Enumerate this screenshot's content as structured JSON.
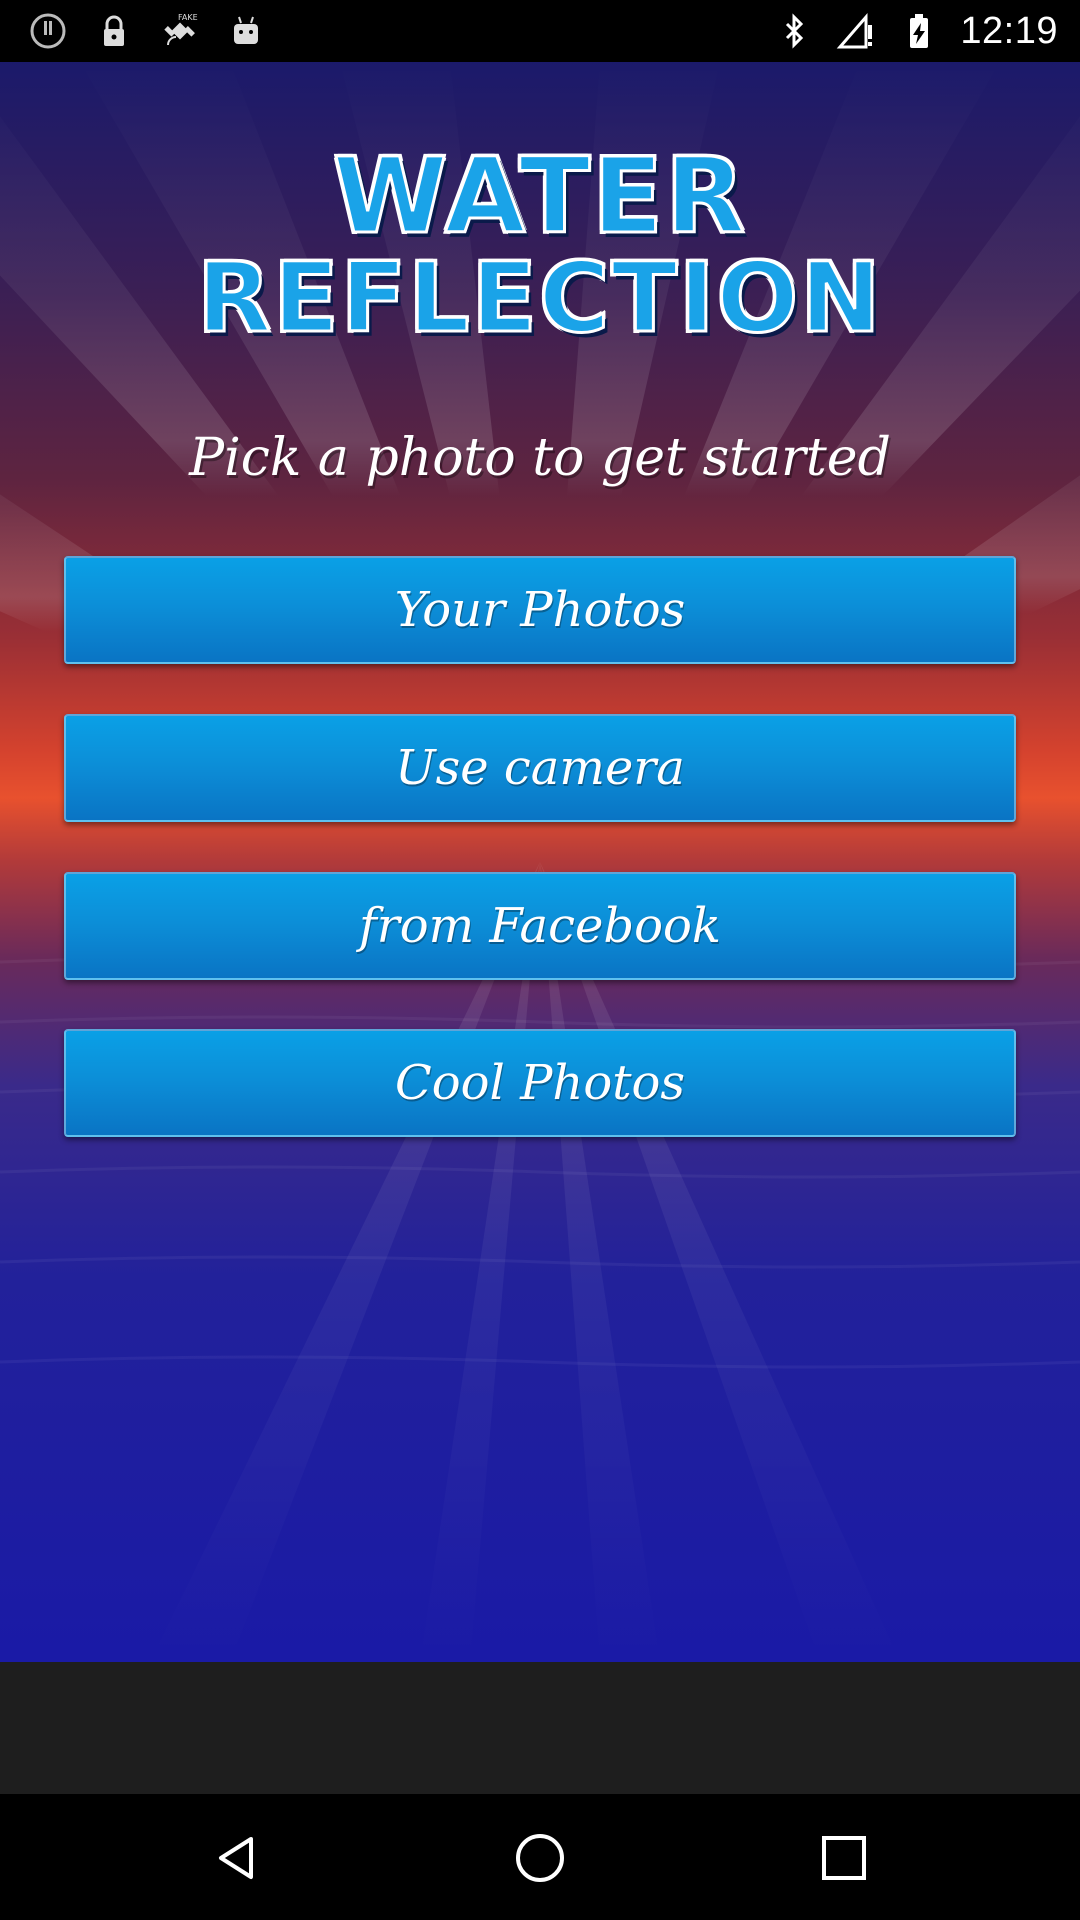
{
  "status_bar": {
    "time": "12:19",
    "left_icons": [
      "info-icon",
      "lock-icon",
      "fake-gps-icon",
      "android-icon"
    ],
    "right_icons": [
      "bluetooth-icon",
      "no-signal-icon",
      "battery-charging-icon"
    ]
  },
  "app": {
    "title_line1": "Water",
    "title_line2": "Reflection",
    "subtitle": "Pick a photo to get started",
    "buttons": [
      {
        "label": "Your Photos"
      },
      {
        "label": "Use camera"
      },
      {
        "label": "from Facebook"
      },
      {
        "label": "Cool Photos"
      }
    ],
    "colors": {
      "button_blue": "#0c8fd8",
      "title_blue": "#1aa3e8",
      "sunset_orange": "#e8512e",
      "deep_blue": "#1a1aa6"
    }
  },
  "nav_bar": {
    "icons": [
      "back-icon",
      "home-icon",
      "recents-icon"
    ]
  }
}
